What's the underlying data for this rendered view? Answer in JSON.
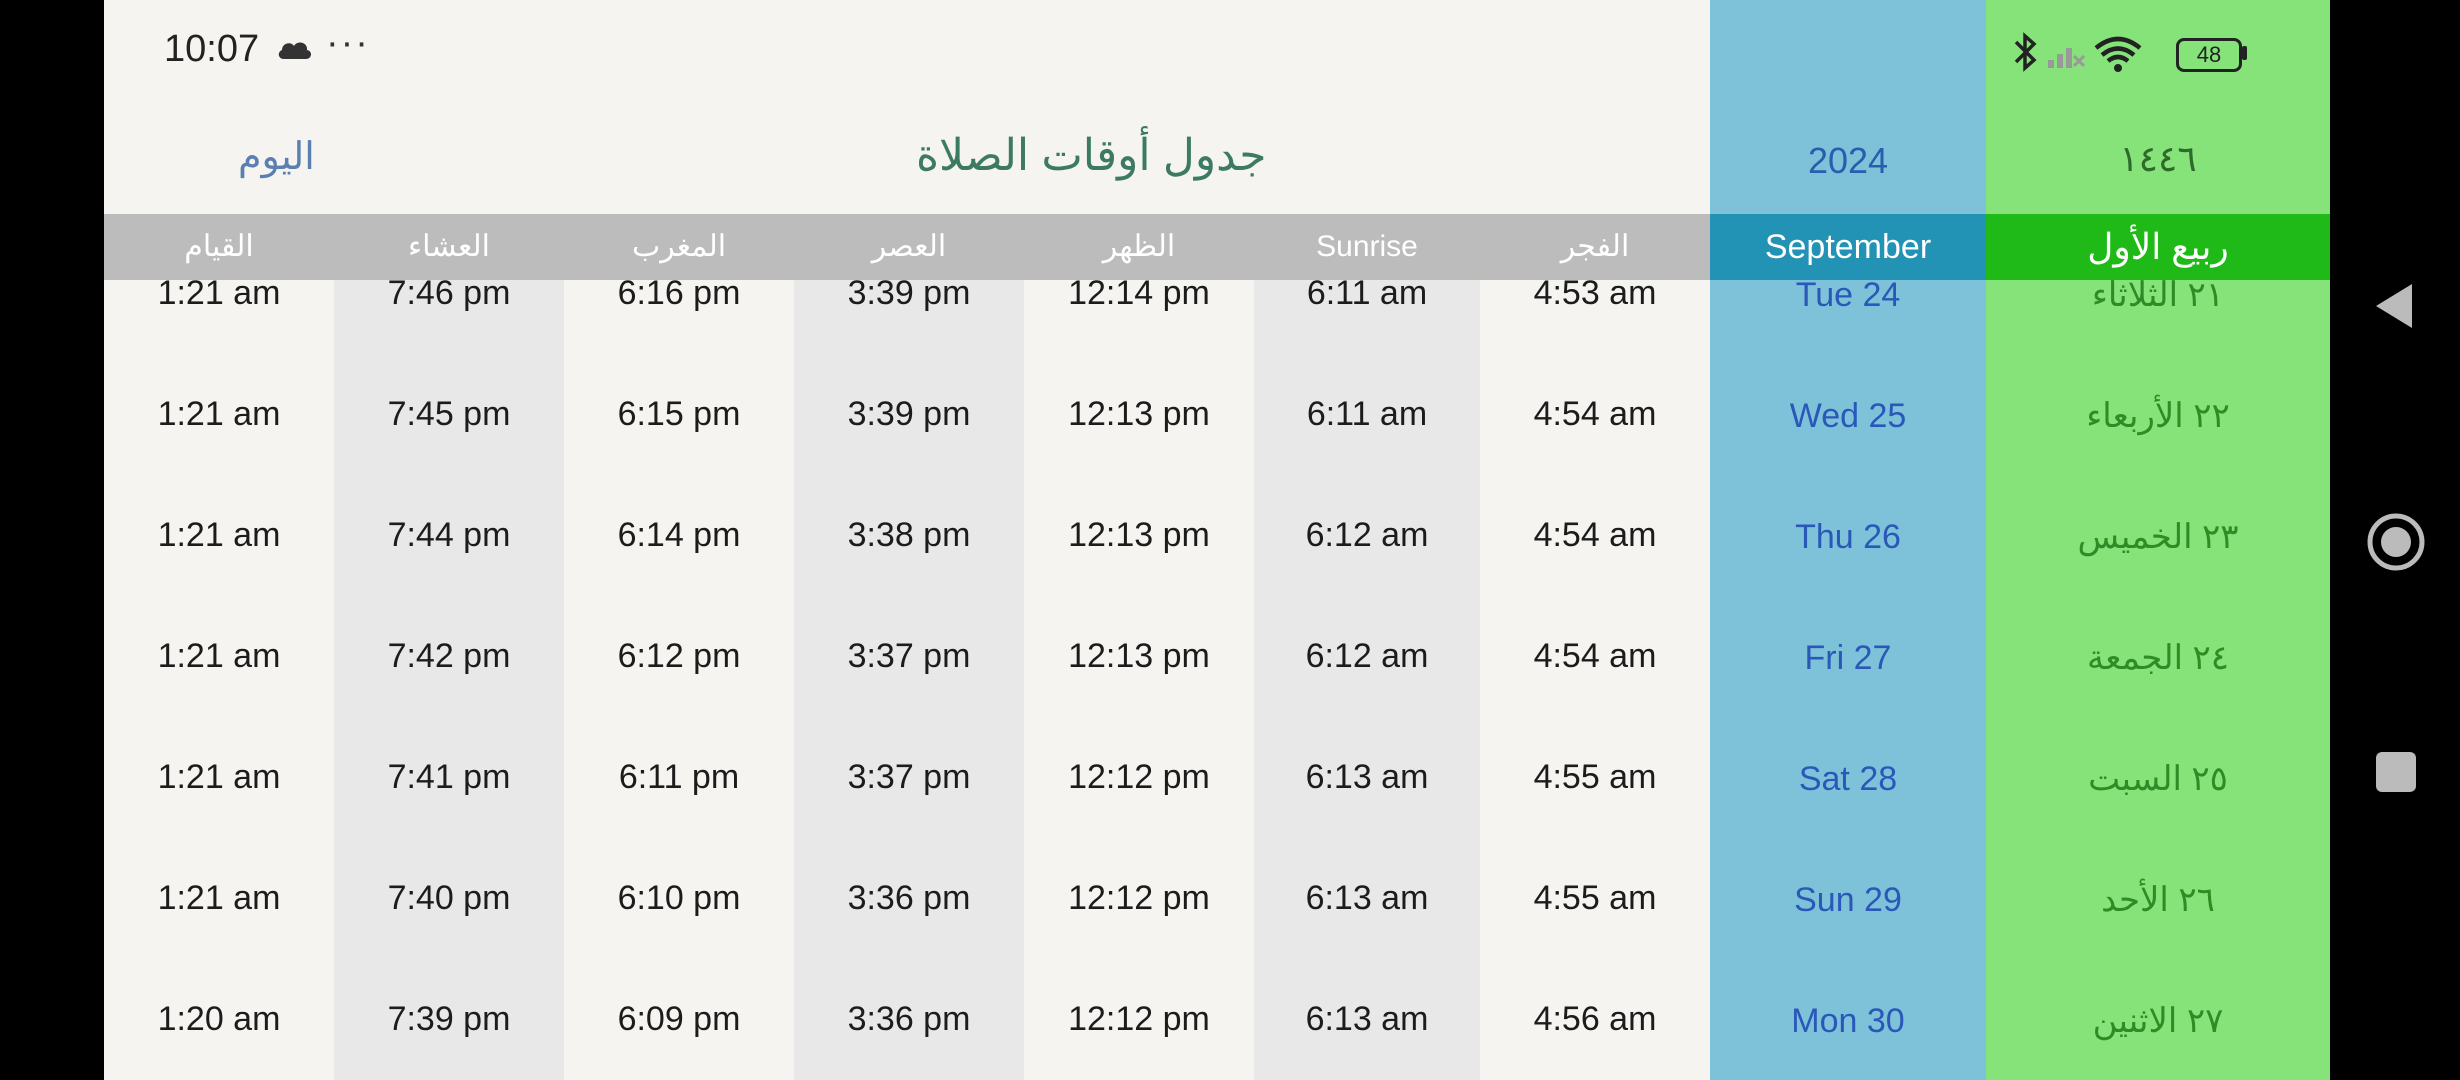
{
  "status_bar": {
    "time": "10:07",
    "more": "···",
    "battery": "48"
  },
  "header": {
    "today_button": "اليوم",
    "title": "جدول أوقات الصلاة",
    "gregorian_year": "2024",
    "hijri_year": "١٤٤٦"
  },
  "columns": {
    "qiyam": "القيام",
    "isha": "العشاء",
    "maghrib": "المغرب",
    "asr": "العصر",
    "dhuhr": "الظهر",
    "sunrise": "Sunrise",
    "fajr": "الفجر",
    "gregorian_month": "September",
    "hijri_month": "ربيع الأول"
  },
  "rows": [
    {
      "qiyam": "1:21 am",
      "isha": "7:46 pm",
      "maghrib": "6:16 pm",
      "asr": "3:39 pm",
      "dhuhr": "12:14 pm",
      "sunrise": "6:11 am",
      "fajr": "4:53 am",
      "greg": "Tue 24",
      "hijri": "٢١ الثلاثاء"
    },
    {
      "qiyam": "1:21 am",
      "isha": "7:45 pm",
      "maghrib": "6:15 pm",
      "asr": "3:39 pm",
      "dhuhr": "12:13 pm",
      "sunrise": "6:11 am",
      "fajr": "4:54 am",
      "greg": "Wed 25",
      "hijri": "٢٢ الأربعاء"
    },
    {
      "qiyam": "1:21 am",
      "isha": "7:44 pm",
      "maghrib": "6:14 pm",
      "asr": "3:38 pm",
      "dhuhr": "12:13 pm",
      "sunrise": "6:12 am",
      "fajr": "4:54 am",
      "greg": "Thu 26",
      "hijri": "٢٣ الخميس"
    },
    {
      "qiyam": "1:21 am",
      "isha": "7:42 pm",
      "maghrib": "6:12 pm",
      "asr": "3:37 pm",
      "dhuhr": "12:13 pm",
      "sunrise": "6:12 am",
      "fajr": "4:54 am",
      "greg": "Fri 27",
      "hijri": "٢٤ الجمعة"
    },
    {
      "qiyam": "1:21 am",
      "isha": "7:41 pm",
      "maghrib": "6:11 pm",
      "asr": "3:37 pm",
      "dhuhr": "12:12 pm",
      "sunrise": "6:13 am",
      "fajr": "4:55 am",
      "greg": "Sat 28",
      "hijri": "٢٥ السبت"
    },
    {
      "qiyam": "1:21 am",
      "isha": "7:40 pm",
      "maghrib": "6:10 pm",
      "asr": "3:36 pm",
      "dhuhr": "12:12 pm",
      "sunrise": "6:13 am",
      "fajr": "4:55 am",
      "greg": "Sun 29",
      "hijri": "٢٦ الأحد"
    },
    {
      "qiyam": "1:20 am",
      "isha": "7:39 pm",
      "maghrib": "6:09 pm",
      "asr": "3:36 pm",
      "dhuhr": "12:12 pm",
      "sunrise": "6:13 am",
      "fajr": "4:56 am",
      "greg": "Mon 30",
      "hijri": "٢٧ الاثنين"
    }
  ],
  "nav": {
    "back_icon": "back-triangle-icon",
    "home_icon": "home-circle-icon",
    "recents_icon": "recents-square-icon"
  }
}
